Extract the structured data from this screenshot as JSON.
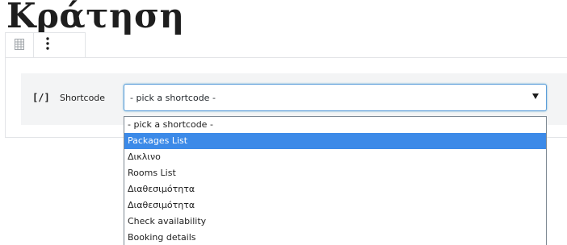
{
  "page": {
    "title": "Κράτηση"
  },
  "toolbar": {
    "block_type_icon": "table-block-icon",
    "more_options_icon": "vertical-ellipsis-icon"
  },
  "shortcode_block": {
    "icon_text": "[/]",
    "label": "Shortcode",
    "select": {
      "value": "- pick a shortcode -"
    },
    "dropdown": {
      "options": [
        {
          "label": "- pick a shortcode -"
        },
        {
          "label": "Packages List"
        },
        {
          "label": "Δικλινο"
        },
        {
          "label": "Rooms List"
        },
        {
          "label": "Διαθεσιμότητα"
        },
        {
          "label": "Διαθεσιμότητα"
        },
        {
          "label": "Check availability"
        },
        {
          "label": "Booking details"
        }
      ],
      "highlighted_index": 1
    }
  },
  "colors": {
    "highlight": "#3c8ae8",
    "select_focus_border": "#5b9dd9",
    "panel_background": "#f3f4f5"
  }
}
